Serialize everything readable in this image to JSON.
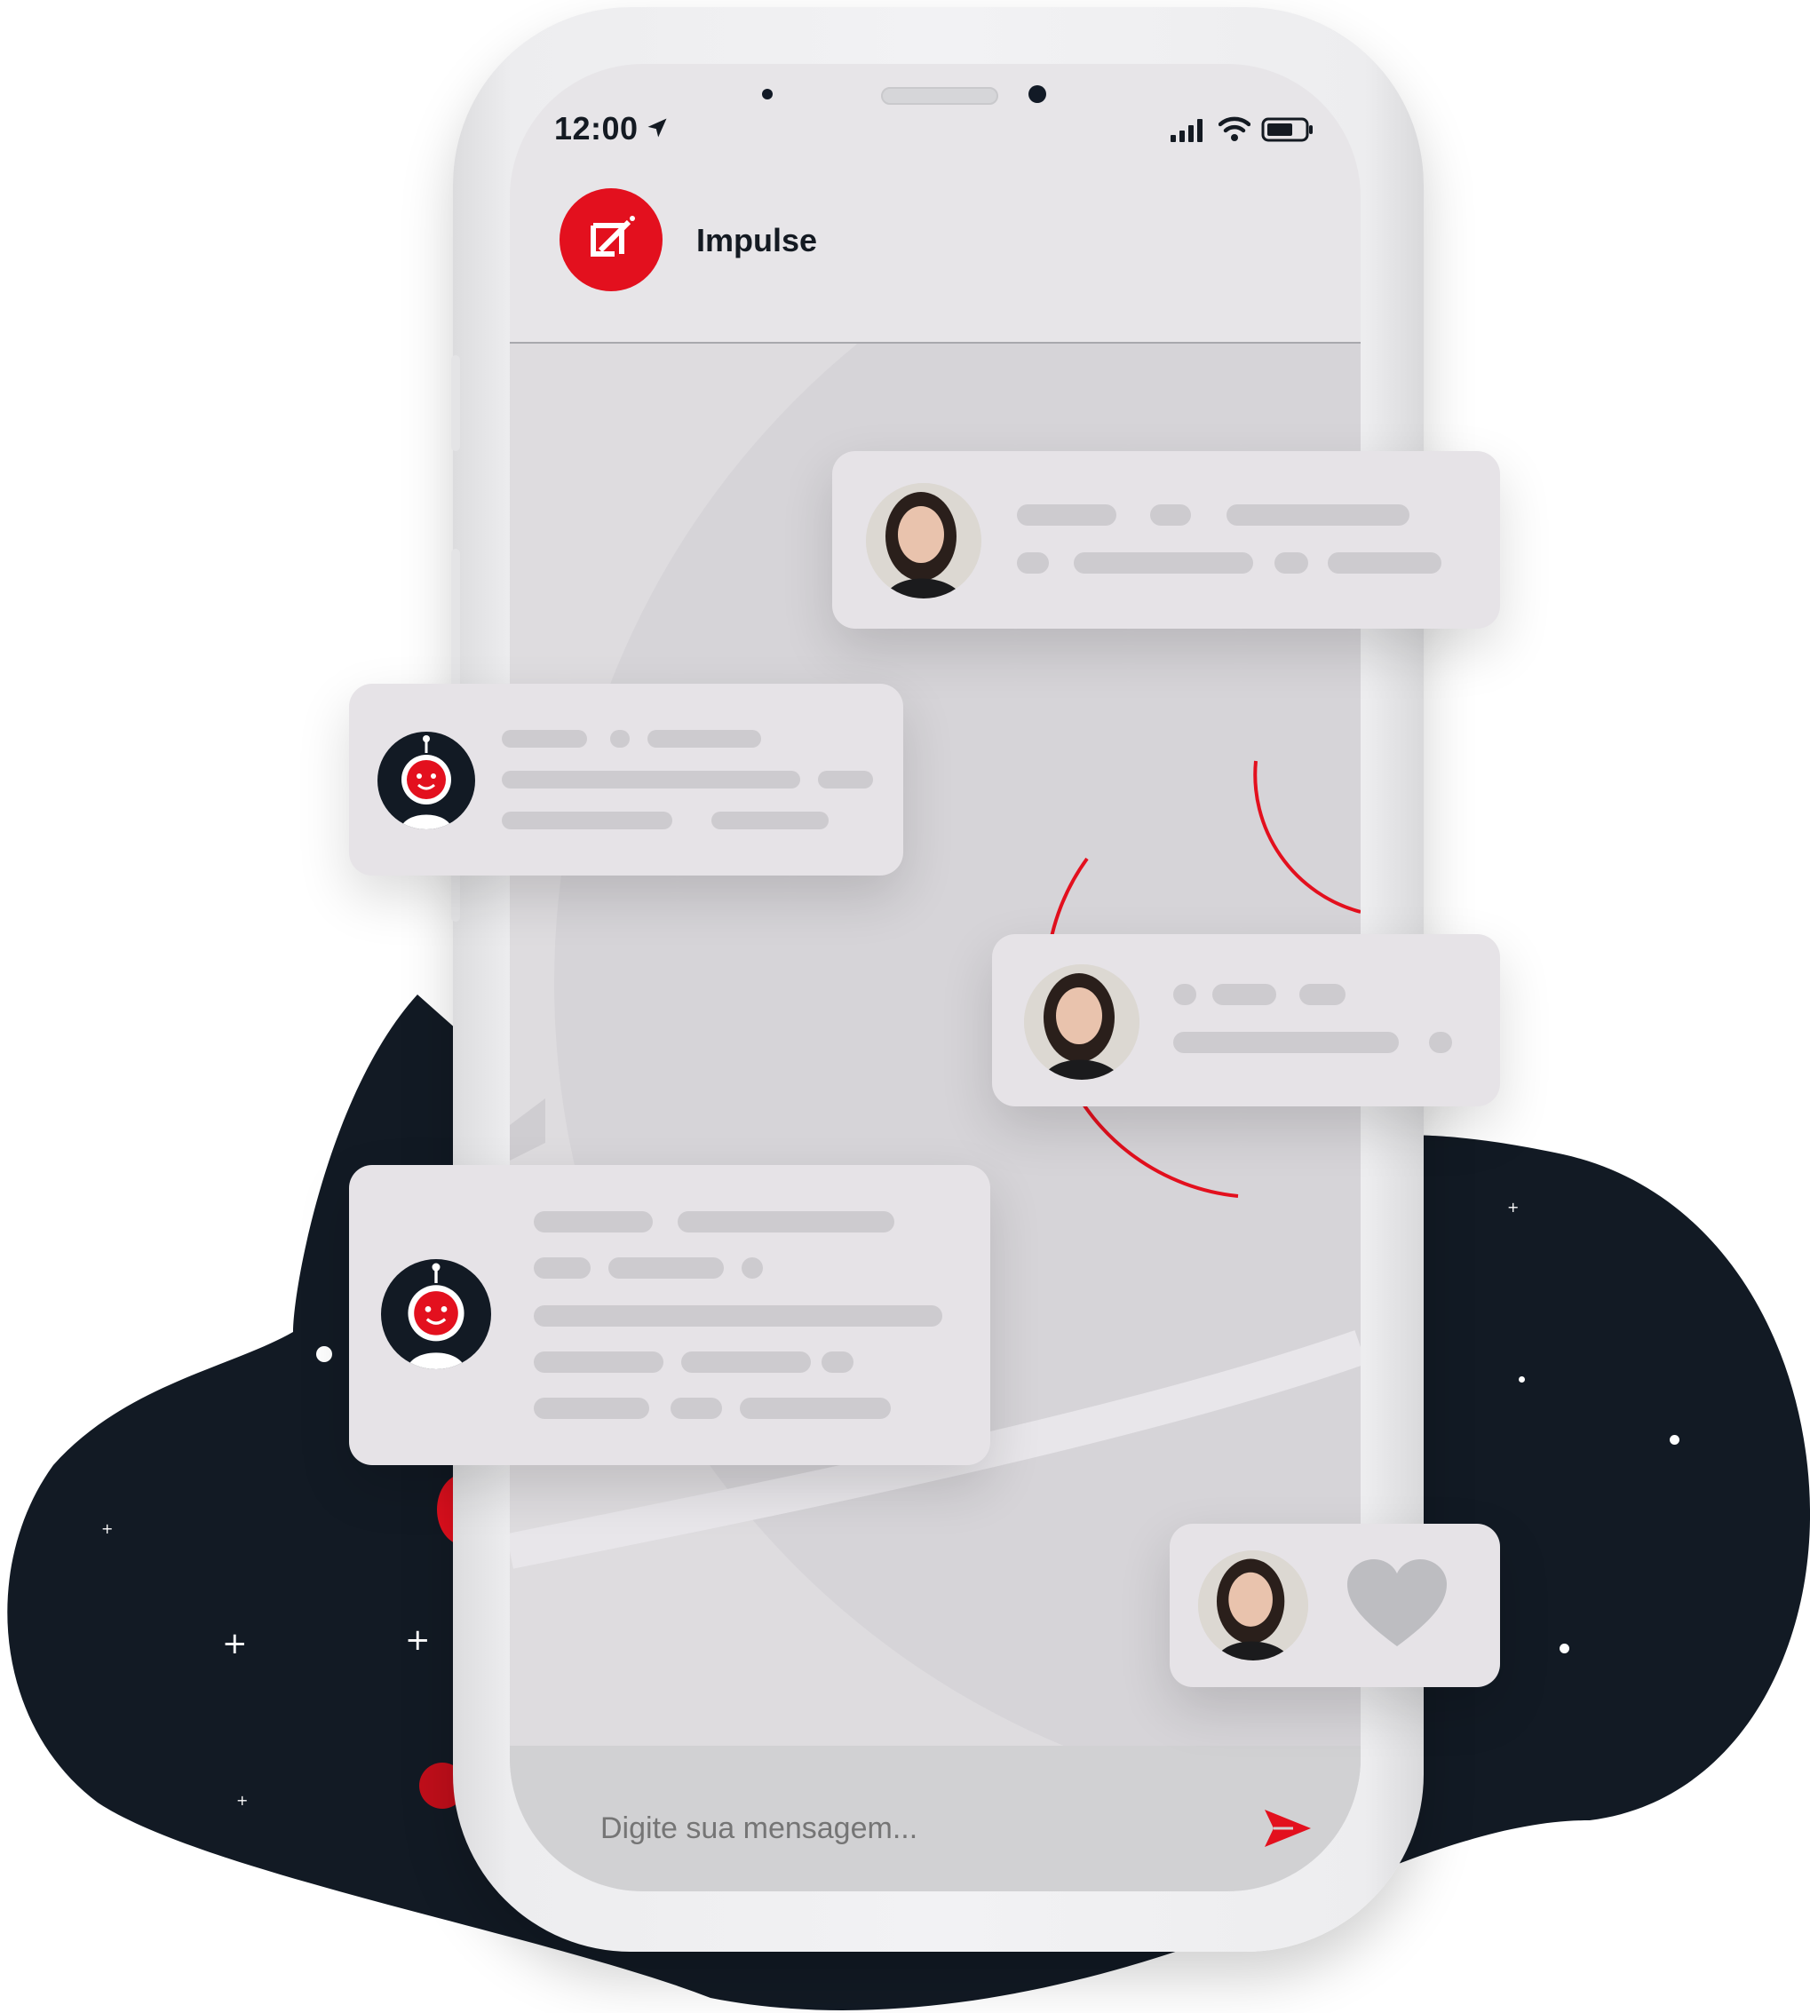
{
  "status_bar": {
    "time": "12:00"
  },
  "header": {
    "title": "Impulse"
  },
  "composer": {
    "placeholder": "Digite sua mensagem..."
  },
  "icons": {
    "location": "location-arrow-icon",
    "signal": "cellular-signal-icon",
    "wifi": "wifi-icon",
    "battery": "battery-icon",
    "send": "send-icon",
    "heart": "heart-icon",
    "bot": "robot-avatar-icon"
  },
  "colors": {
    "accent": "#e3101e",
    "background_blob": "#121a24",
    "bubble": "#e6e3e7",
    "placeholder_bar": "#cdcbcf",
    "heart": "#bdbdc1"
  },
  "messages": [
    {
      "sender": "user",
      "content": "placeholder"
    },
    {
      "sender": "bot",
      "content": "placeholder"
    },
    {
      "sender": "user",
      "content": "placeholder"
    },
    {
      "sender": "bot",
      "content": "placeholder"
    },
    {
      "sender": "user",
      "content": "heart"
    }
  ]
}
